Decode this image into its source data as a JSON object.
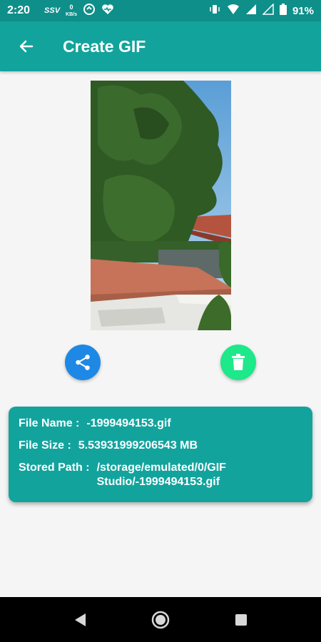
{
  "status_bar": {
    "time": "2:20",
    "network_speed_top": "0",
    "network_speed_unit": "KB/s",
    "battery": "91%"
  },
  "app_bar": {
    "title": "Create GIF"
  },
  "info_card": {
    "file_name_label": "File Name :",
    "file_name": "-1999494153.gif",
    "file_size_label": "File Size :",
    "file_size": "5.53931999206543 MB",
    "stored_path_label": "Stored Path :",
    "stored_path": "/storage/emulated/0/GIF Studio/-1999494153.gif"
  },
  "colors": {
    "status_bar": "#0e8f8a",
    "app_bar": "#12a39c",
    "share_button": "#1e88e5",
    "delete_button": "#1de88a",
    "card": "#13a39d"
  },
  "icons": {
    "back": "arrow-left-icon",
    "share": "share-icon",
    "delete": "trash-icon",
    "nav_back": "triangle-back-icon",
    "nav_home": "circle-home-icon",
    "nav_recents": "square-recents-icon"
  }
}
